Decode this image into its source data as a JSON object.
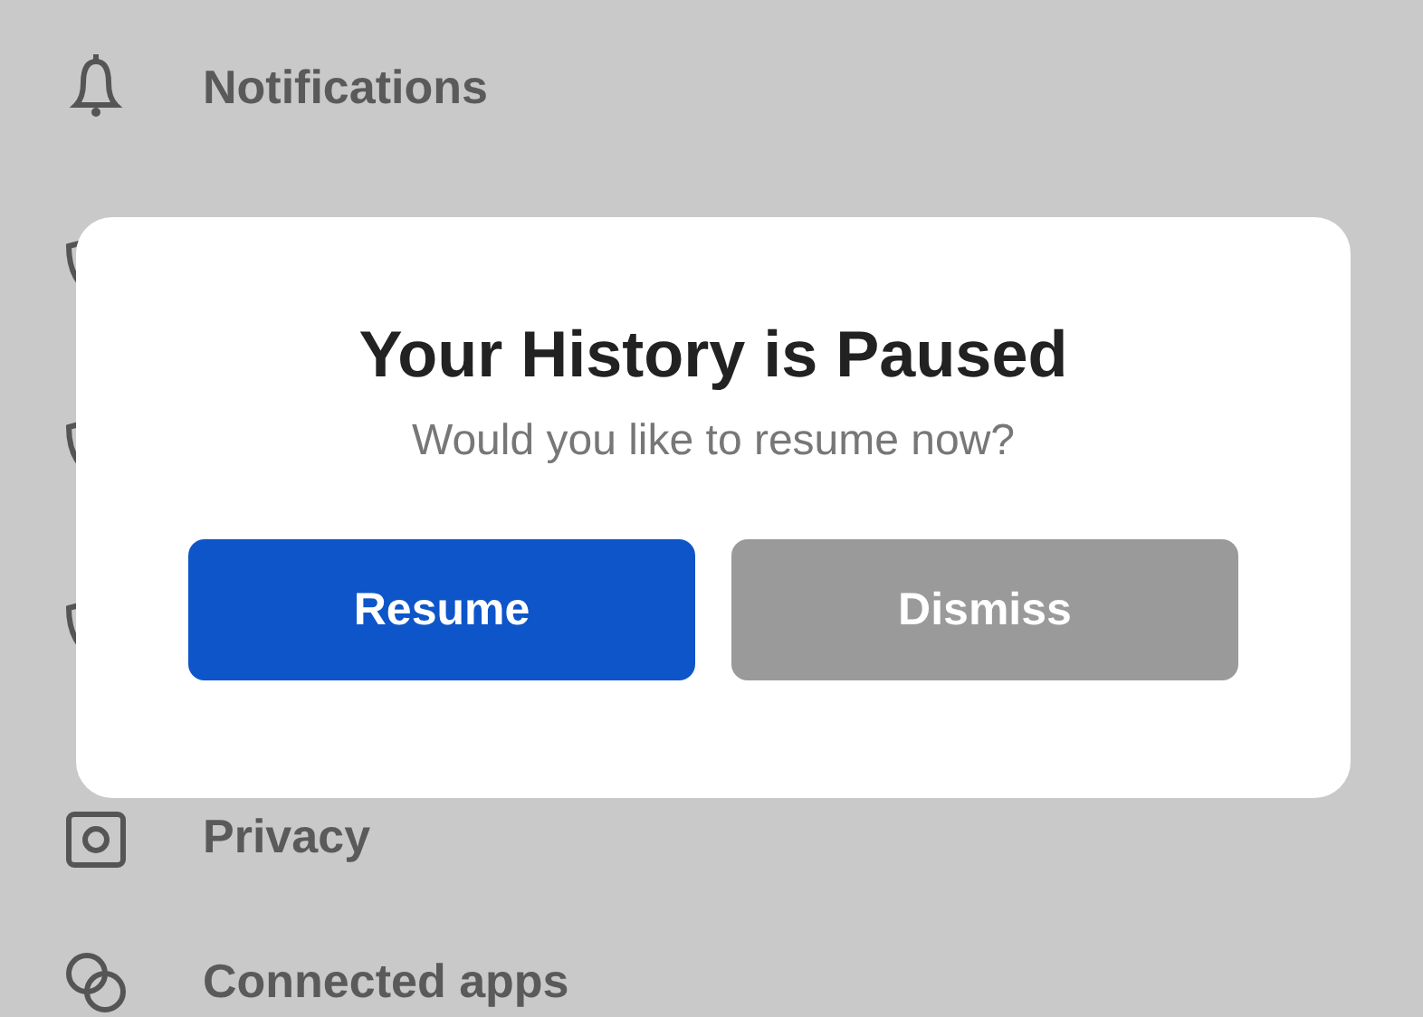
{
  "settings_items": [
    {
      "label": "Notifications",
      "kind": "bell"
    },
    {
      "label": "Privacy",
      "kind": "camera"
    },
    {
      "label": "Connected apps",
      "kind": "link"
    }
  ],
  "dialog": {
    "title": "Your History is Paused",
    "message": "Would you like to resume now?",
    "buttons": [
      {
        "label": "Resume",
        "kind": "primary"
      },
      {
        "label": "Dismiss",
        "kind": "secondary"
      }
    ]
  }
}
